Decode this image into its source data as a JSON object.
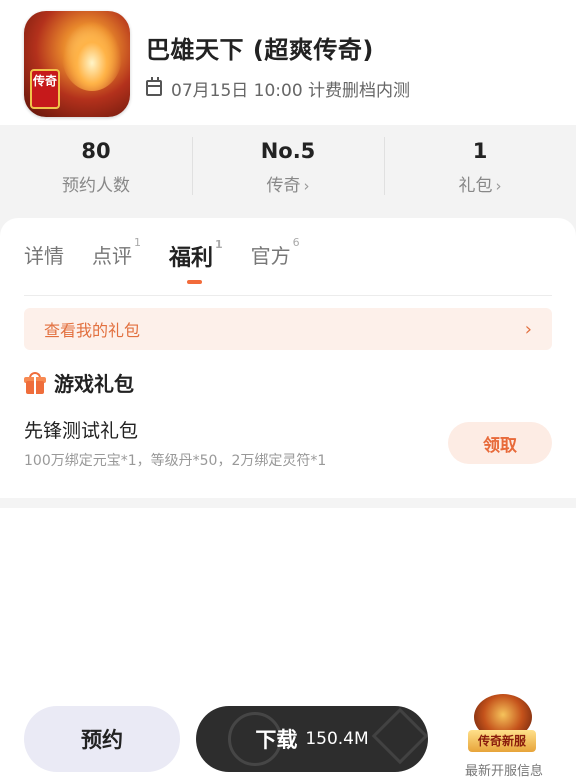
{
  "app": {
    "title": "巴雄天下 (超爽传奇)",
    "icon_tag": "传奇",
    "date_info": "07月15日 10:00 计费删档内测"
  },
  "stats": [
    {
      "value": "80",
      "label": "预约人数",
      "has_chevron": false
    },
    {
      "value": "No.5",
      "label": "传奇",
      "has_chevron": true
    },
    {
      "value": "1",
      "label": "礼包",
      "has_chevron": true
    }
  ],
  "tabs": [
    {
      "label": "详情",
      "count": ""
    },
    {
      "label": "点评",
      "count": "1"
    },
    {
      "label": "福利",
      "count": "1",
      "active": true
    },
    {
      "label": "官方",
      "count": "6"
    }
  ],
  "gift_link": {
    "label": "查看我的礼包",
    "chevron": "›"
  },
  "gift_section": {
    "title": "游戏礼包",
    "icon": "gift-icon",
    "item": {
      "name": "先锋测试礼包",
      "description": "100万绑定元宝*1，等级丹*50，2万绑定灵符*1",
      "action_label": "领取"
    }
  },
  "bottom_bar": {
    "reserve_label": "预约",
    "download_label": "下载",
    "download_size": "150.4M",
    "news_badge_text": "传奇新服",
    "news_caption": "最新开服信息"
  },
  "colors": {
    "accent": "#f26b3a",
    "accent_light_bg": "#fdf0ea",
    "download_bg": "#2d2d2d",
    "reserve_bg": "#eaeaf5"
  }
}
